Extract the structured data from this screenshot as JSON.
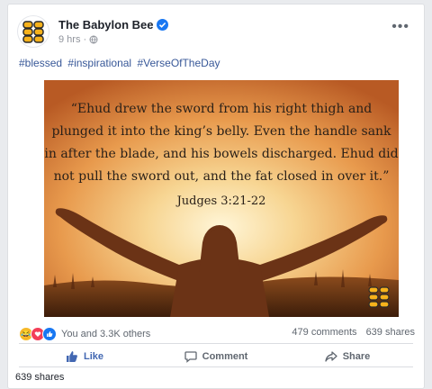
{
  "post": {
    "page_name": "The Babylon Bee",
    "time": "9 hrs",
    "meta_separator": "·",
    "hashtags": [
      "#blessed",
      "#inspirational",
      "#VerseOfTheDay"
    ],
    "image": {
      "quote": "“Ehud drew the sword from his right thigh and plunged it into the king’s belly. Even the handle sank in after the blade, and his bowels discharged. Ehud did not pull the sword out, and the fat closed in over it.”",
      "citation": "Judges 3:21-22"
    },
    "reactions_text": "You and 3.3K others",
    "comments": "479 comments",
    "shares": "639 shares",
    "actions": {
      "like": "Like",
      "comment": "Comment",
      "share": "Share"
    },
    "footer_shares": "639 shares"
  },
  "icons": {
    "avatar": "babylon-bee-logo",
    "verified": "verified-badge-icon",
    "privacy": "globe-icon",
    "more": "more-icon",
    "like": "thumbs-up-icon",
    "comment": "comment-icon",
    "share": "share-arrow-icon"
  },
  "colors": {
    "link": "#385898",
    "like_blue": "#4267b2",
    "verified": "#1877f2",
    "bee_yellow": "#f7b21b"
  }
}
